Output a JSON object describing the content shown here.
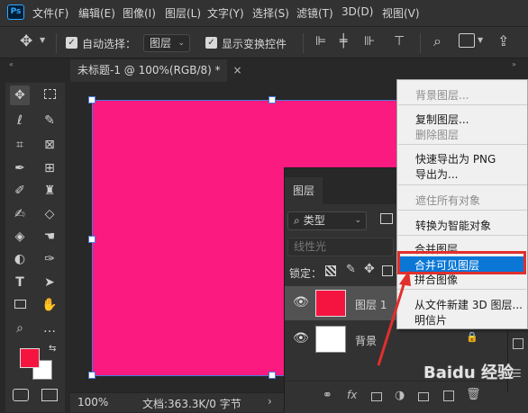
{
  "app_logo": "Ps",
  "menu": [
    "文件(F)",
    "编辑(E)",
    "图像(I)",
    "图层(L)",
    "文字(Y)",
    "选择(S)",
    "滤镜(T)",
    "3D(D)",
    "视图(V)"
  ],
  "options_bar": {
    "auto_select_label": "自动选择：",
    "auto_select_target": "图层",
    "show_transform_label": "显示变换控件"
  },
  "document_tab": {
    "title": "未标题-1 @ 100%(RGB/8) *",
    "close_symbol": "×"
  },
  "canvas": {
    "fill_color": "#fb1a7f"
  },
  "status_bar": {
    "zoom": "100%",
    "doc_info": "文档:363.3K/0 字节"
  },
  "layers_panel": {
    "tab_label": "图层",
    "filter_label": "类型",
    "blend_mode": "线性光",
    "lock_label": "锁定：",
    "layers": [
      {
        "name": "图层 1",
        "thumb_color": "#f5143f"
      },
      {
        "name": "背景",
        "thumb_color": "#ffffff"
      }
    ]
  },
  "context_menu": {
    "groups": [
      [
        {
          "label": "背景图层...",
          "enabled": false
        }
      ],
      [
        {
          "label": "复制图层...",
          "enabled": true
        },
        {
          "label": "删除图层",
          "enabled": false
        }
      ],
      [
        {
          "label": "快速导出为 PNG",
          "enabled": true
        },
        {
          "label": "导出为...",
          "enabled": true
        }
      ],
      [
        {
          "label": "遮住所有对象",
          "enabled": false
        }
      ],
      [
        {
          "label": "转换为智能对象",
          "enabled": true
        }
      ],
      [
        {
          "label": "合并图层",
          "enabled": true
        },
        {
          "label": "合并可见图层",
          "enabled": true,
          "highlighted": true
        },
        {
          "label": "拼合图像",
          "enabled": true
        }
      ],
      [
        {
          "label": "从文件新建 3D 图层...",
          "enabled": true
        },
        {
          "label": "明信片",
          "enabled": true
        }
      ]
    ]
  },
  "colors": {
    "foreground": "#f5143f",
    "background": "#ffffff",
    "highlight": "#0a77d6",
    "annotation": "#e0302d"
  },
  "watermark": "Baidu 经验"
}
